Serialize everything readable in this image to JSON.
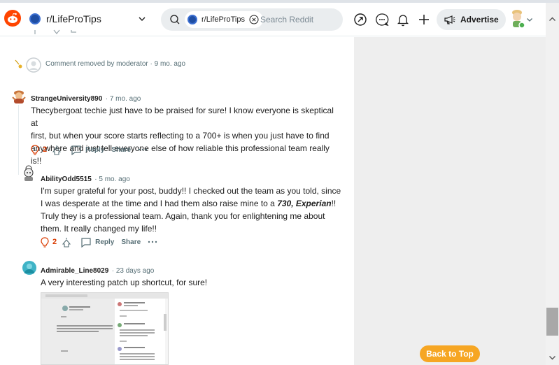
{
  "header": {
    "subreddit": "r/LifeProTips",
    "search_chip": "r/LifeProTips",
    "search_placeholder": "Search Reddit",
    "advertise_label": "Advertise"
  },
  "removed_comment": {
    "text": "Comment removed by moderator",
    "time": "9 mo. ago"
  },
  "comments": [
    {
      "username": "StrangeUniversity890",
      "time": "7 mo. ago",
      "lines": [
        "Thecybergoat techie just have to be praised for sure! I know everyone is skeptical at",
        "first, but when your score starts reflecting to a 700+ is when you just have to find",
        "anywhere and just tell everyone else of how reliable this professional team really is!!"
      ],
      "votes": "2",
      "reply": "Reply",
      "share": "Share"
    },
    {
      "username": "AbilityOdd5515",
      "time": "5 mo. ago",
      "line1": "I'm super grateful for your post, buddy!! I checked out the team as you told, since",
      "line2_pre": "I was desperate at the time and I had them also raise mine to a ",
      "line2_emph": "730, Experian",
      "line2_post": "!!",
      "line3": "Truly they is a professional team. Again, thank you for enlightening me about",
      "line4": "them. It really changed my life!!",
      "votes": "2",
      "reply": "Reply",
      "share": "Share"
    },
    {
      "username": "Admirable_Line8029",
      "time": "23 days ago",
      "text": "A very interesting patch up shortcut, for sure!"
    }
  ],
  "back_to_top": "Back to Top",
  "colors": {
    "accent": "#f6a623",
    "upvote": "#d93a00"
  }
}
